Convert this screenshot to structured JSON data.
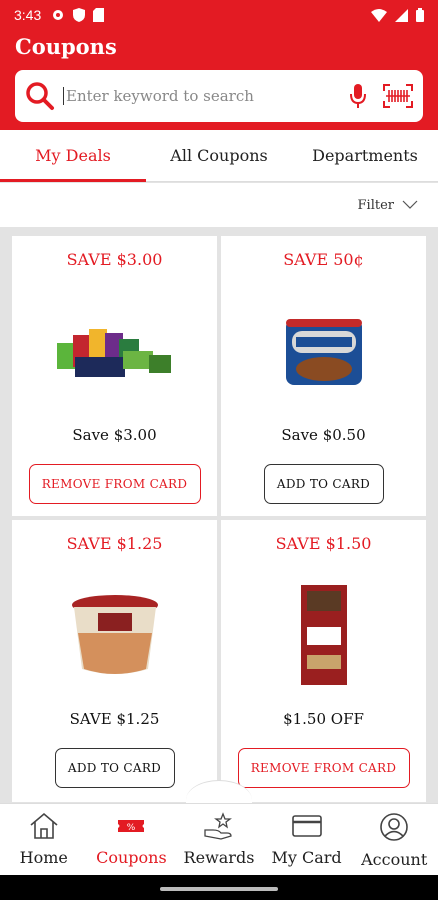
{
  "status_bar": {
    "time": "3:43"
  },
  "app_bar": {
    "title": "Coupons",
    "search_placeholder": "Enter keyword to search"
  },
  "tabs": [
    {
      "label": "My Deals",
      "active": true
    },
    {
      "label": "All Coupons",
      "active": false
    },
    {
      "label": "Departments",
      "active": false
    }
  ],
  "filter": {
    "label": "Filter"
  },
  "coupons": [
    {
      "save": "SAVE $3.00",
      "image": "snack-drink-bundle",
      "desc": "Save $3.00",
      "button": "REMOVE FROM CARD",
      "state": "remove"
    },
    {
      "save": "SAVE 50¢",
      "image": "blue-diamond-almonds-can",
      "desc": "Save $0.50",
      "button": "ADD TO CARD",
      "state": "add"
    },
    {
      "save": "SAVE $1.25",
      "image": "parmesan-cup",
      "desc": "SAVE $1.25",
      "button": "ADD TO CARD",
      "state": "add"
    },
    {
      "save": "SAVE $1.50",
      "image": "eight-oclock-coffee-bag",
      "desc": "$1.50 OFF",
      "button": "REMOVE FROM CARD",
      "state": "remove"
    }
  ],
  "bottom_nav": [
    {
      "label": "Home",
      "icon": "home-icon",
      "active": false
    },
    {
      "label": "Coupons",
      "icon": "coupon-icon",
      "active": true
    },
    {
      "label": "Rewards",
      "icon": "rewards-icon",
      "active": false
    },
    {
      "label": "My Card",
      "icon": "card-icon",
      "active": false
    },
    {
      "label": "Account",
      "icon": "account-icon",
      "active": false
    }
  ],
  "colors": {
    "brand": "#e31b23",
    "background": "#e3e3e3"
  }
}
